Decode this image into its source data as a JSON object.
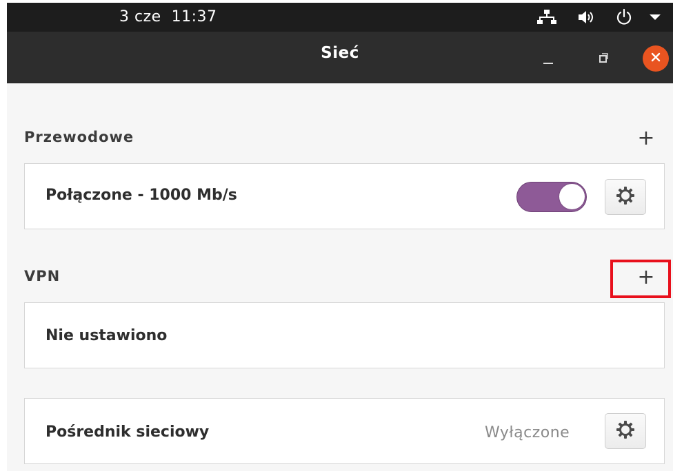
{
  "topbar": {
    "clock": "3 cze  11:37",
    "icons": [
      "network-wired-icon",
      "volume-icon",
      "power-icon",
      "dropdown-arrow-icon"
    ]
  },
  "window": {
    "title": "Sieć",
    "buttons": [
      "minimize-icon",
      "restore-icon",
      "close-icon"
    ]
  },
  "wired": {
    "heading": "Przewodowe",
    "add_label": "+",
    "connection_label": "Połączone - 1000 Mb/s",
    "toggle_on": true,
    "settings_icon": "gear-icon"
  },
  "vpn": {
    "heading": "VPN",
    "add_label": "+",
    "empty_label": "Nie ustawiono"
  },
  "proxy": {
    "label": "Pośrednik sieciowy",
    "status": "Wyłączone",
    "settings_icon": "gear-icon"
  },
  "colors": {
    "accent_toggle": "#8e5a97",
    "close_button": "#e95420",
    "highlight": "#e8101c",
    "topbar": "#1d1d1d",
    "headerbar": "#2d2d2d"
  }
}
